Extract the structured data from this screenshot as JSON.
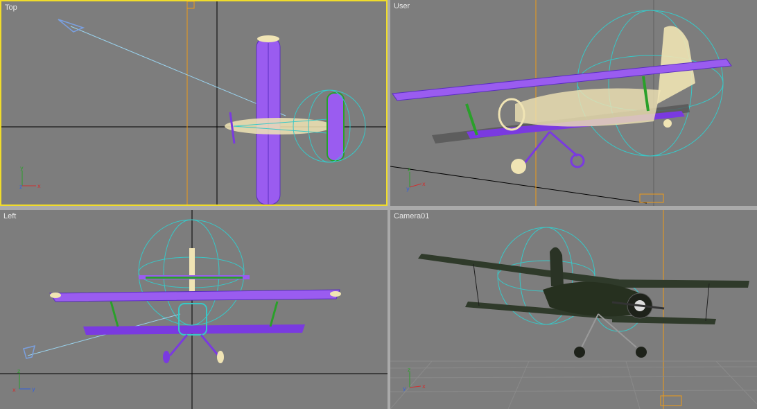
{
  "viewports": {
    "top": {
      "label": "Top",
      "active": true
    },
    "user": {
      "label": "User",
      "active": false
    },
    "left": {
      "label": "Left",
      "active": false
    },
    "camera": {
      "label": "Camera01",
      "active": false
    }
  },
  "axis_letters": {
    "x": "x",
    "y": "y",
    "z": "z"
  },
  "colors": {
    "viewport_bg": "#7d7d7d",
    "active_border": "#f0dc2a",
    "grid_axis": "#000000",
    "grid_line": "#646464",
    "wireframe_purple": "#9a5cf0",
    "wireframe_cream": "#f0e4b4",
    "wireframe_green": "#2aa02a",
    "helper_cyan": "#38c8c8",
    "camera_orange": "#f09a18",
    "render_plane": "#2f3a2a"
  }
}
